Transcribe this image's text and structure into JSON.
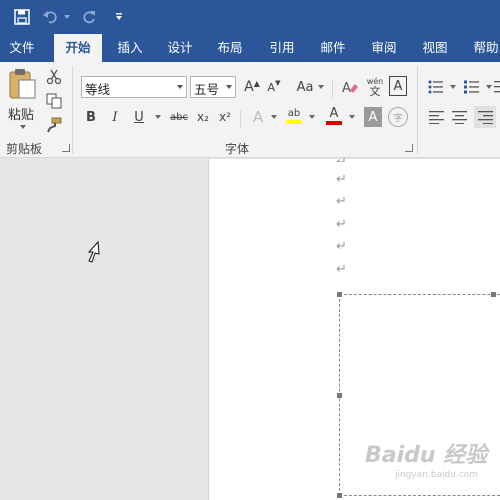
{
  "window": {
    "quick_access": [
      "save-icon",
      "undo-icon",
      "redo-icon",
      "customize-quick-access-icon"
    ]
  },
  "tabs": [
    {
      "label": "文件",
      "active": false
    },
    {
      "label": "开始",
      "active": true
    },
    {
      "label": "插入",
      "active": false
    },
    {
      "label": "设计",
      "active": false
    },
    {
      "label": "布局",
      "active": false
    },
    {
      "label": "引用",
      "active": false
    },
    {
      "label": "邮件",
      "active": false
    },
    {
      "label": "审阅",
      "active": false
    },
    {
      "label": "视图",
      "active": false
    },
    {
      "label": "帮助",
      "active": false
    }
  ],
  "clipboard": {
    "paste_label": "粘贴",
    "group_label": "剪贴板",
    "icons": [
      "paste-icon",
      "cut-icon",
      "copy-icon",
      "format-painter-icon"
    ]
  },
  "font": {
    "group_label": "字体",
    "font_name": "等线",
    "font_size": "五号",
    "grow_font_glyph": "A",
    "shrink_font_glyph": "A",
    "change_case_glyph": "Aa",
    "phonetic_top": "wén",
    "phonetic_bottom": "文",
    "char_border_glyph": "A",
    "bold_glyph": "B",
    "italic_glyph": "I",
    "underline_glyph": "U",
    "strikethrough_glyph": "abc",
    "subscript_glyph": "x₂",
    "superscript_glyph": "x²",
    "text_effects_glyph": "A",
    "highlight_glyph": "ab",
    "font_color_glyph": "A",
    "char_shading_glyph": "A",
    "enclose_char_glyph": "字"
  },
  "colors": {
    "accent": "#2b579a",
    "highlight": "#ffff00",
    "font_color": "#e00000"
  },
  "document": {
    "paragraph_mark": "↵",
    "paragraph_count": 6
  },
  "watermark": {
    "text": "Baidu 经验",
    "sub": "jingyan.baidu.com"
  }
}
